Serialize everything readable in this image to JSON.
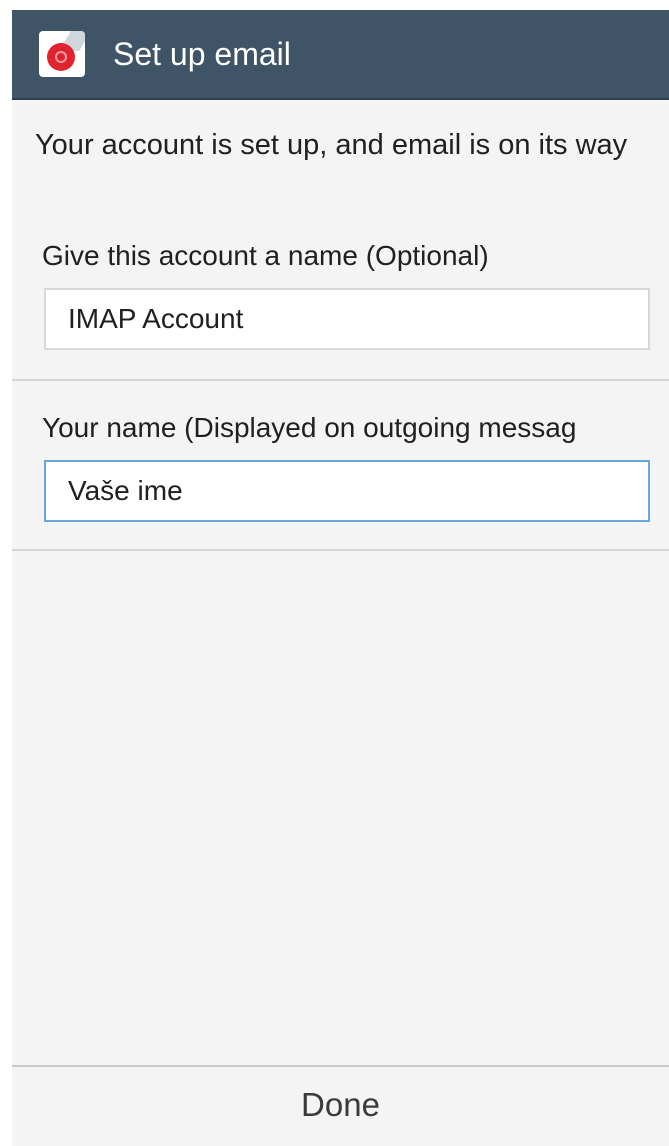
{
  "app_bar": {
    "title": "Set up email",
    "icon": "email-app-icon"
  },
  "message": "Your account is set up, and email is on its way",
  "fields": {
    "account_name": {
      "label": "Give this account a name (Optional)",
      "value": "IMAP Account"
    },
    "your_name": {
      "label": "Your name (Displayed on outgoing messag",
      "value": "Vaše ime"
    }
  },
  "footer": {
    "done_label": "Done"
  },
  "colors": {
    "app_bar": "#3f5567",
    "background": "#f4f4f4",
    "focused_field_border": "#6aa6de"
  }
}
